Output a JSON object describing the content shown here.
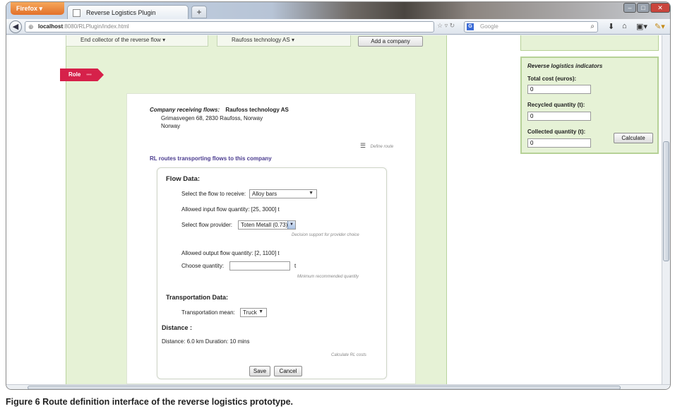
{
  "browser": {
    "app_button": "Firefox",
    "tab_title": "Reverse Logistics Plugin",
    "new_tab": "+",
    "url_host": "localhost",
    "url_path": ":8080/RLPlugin/index.html",
    "search_placeholder": "Google",
    "search_engine_icon": "G"
  },
  "top_strip": {
    "cell1": "End collector of the reverse flow",
    "cell2": "Raufoss technology AS",
    "add_company": "Add a company"
  },
  "role_tab": "Role",
  "company": {
    "heading_label": "Company receiving flows:",
    "name": "Raufoss technology AS",
    "address": "Grimasvegen 68, 2830 Raufoss, Norway",
    "country": "Norway",
    "define_route": "Define route"
  },
  "routes_heading": "RL routes transporting flows to this company",
  "flow_data": {
    "heading": "Flow Data:",
    "select_flow_label": "Select the flow to receive:",
    "select_flow_value": "Alloy bars",
    "allowed_input": "Allowed input flow quantity: [25, 3000] t",
    "select_provider_label": "Select flow provider:",
    "select_provider_value": "Toten Metall (0.73)",
    "decision_support": "Decision support for provider choice",
    "allowed_output": "Allowed output flow quantity: [2, 1100] t",
    "choose_quantity_label": "Choose quantity:",
    "choose_quantity_unit": "t",
    "choose_quantity_value": "",
    "min_recommended": "Minimum recommended quantity"
  },
  "transport_data": {
    "heading": "Transportation Data:",
    "mean_label": "Transportation mean:",
    "mean_value": "Truck"
  },
  "distance": {
    "heading": "Distance :",
    "text": "Distance: 6.0 km Duration: 10 mins",
    "calculate_costs": "Calculate RL costs"
  },
  "actions": {
    "save": "Save",
    "cancel": "Cancel"
  },
  "indicators": {
    "title": "Reverse logistics indicators",
    "total_cost_label": "Total cost (euros):",
    "total_cost_value": "0",
    "recycled_label": "Recycled quantity (t):",
    "recycled_value": "0",
    "collected_label": "Collected quantity (t):",
    "collected_value": "0",
    "calculate": "Calculate"
  },
  "caption": {
    "figure_label": "Figure 6",
    "text": "Route definition interface of the reverse logistics prototype."
  },
  "colors": {
    "green_panel": "#e6f2d6",
    "role_red": "#d6214a",
    "route_link": "#4b3c8f"
  }
}
